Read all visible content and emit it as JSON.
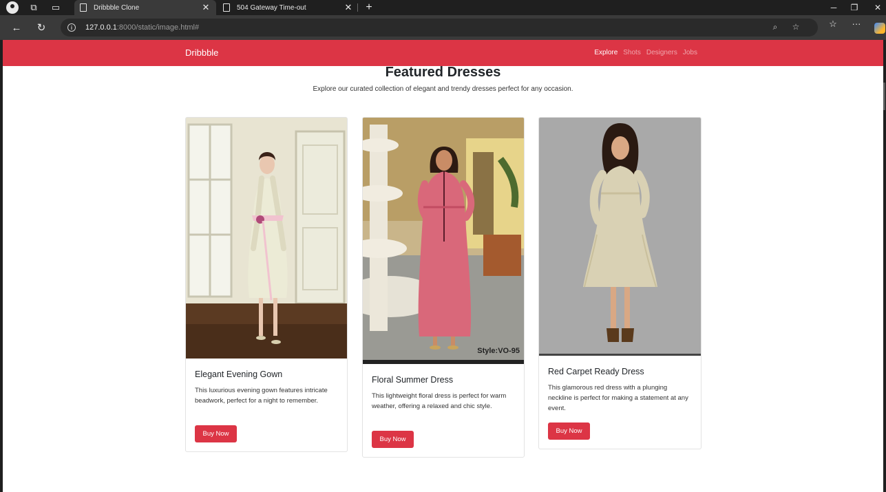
{
  "browser": {
    "tabs": [
      {
        "title": "Dribbble Clone",
        "active": true
      },
      {
        "title": "504 Gateway Time-out",
        "active": false
      }
    ],
    "url": {
      "host": "127.0.0.1",
      "rest": ":8000/static/image.html#"
    }
  },
  "site": {
    "brand": "Dribbble",
    "nav": [
      "Explore",
      "Shots",
      "Designers",
      "Jobs"
    ],
    "active_nav": "Explore",
    "accent_color": "#dc3545"
  },
  "section": {
    "title": "Featured Dresses",
    "subtitle": "Explore our curated collection of elegant and trendy dresses perfect for any occasion."
  },
  "cards": [
    {
      "title": "Elegant Evening Gown",
      "text": "This luxurious evening gown features intricate beadwork, perfect for a night to remember.",
      "button": "Buy Now"
    },
    {
      "title": "Floral Summer Dress",
      "text": "This lightweight floral dress is perfect for warm weather, offering a relaxed and chic style.",
      "button": "Buy Now",
      "image_caption": "Style:VO-95"
    },
    {
      "title": "Red Carpet Ready Dress",
      "text": "This glamorous red dress with a plunging neckline is perfect for making a statement at any event.",
      "button": "Buy Now"
    }
  ]
}
